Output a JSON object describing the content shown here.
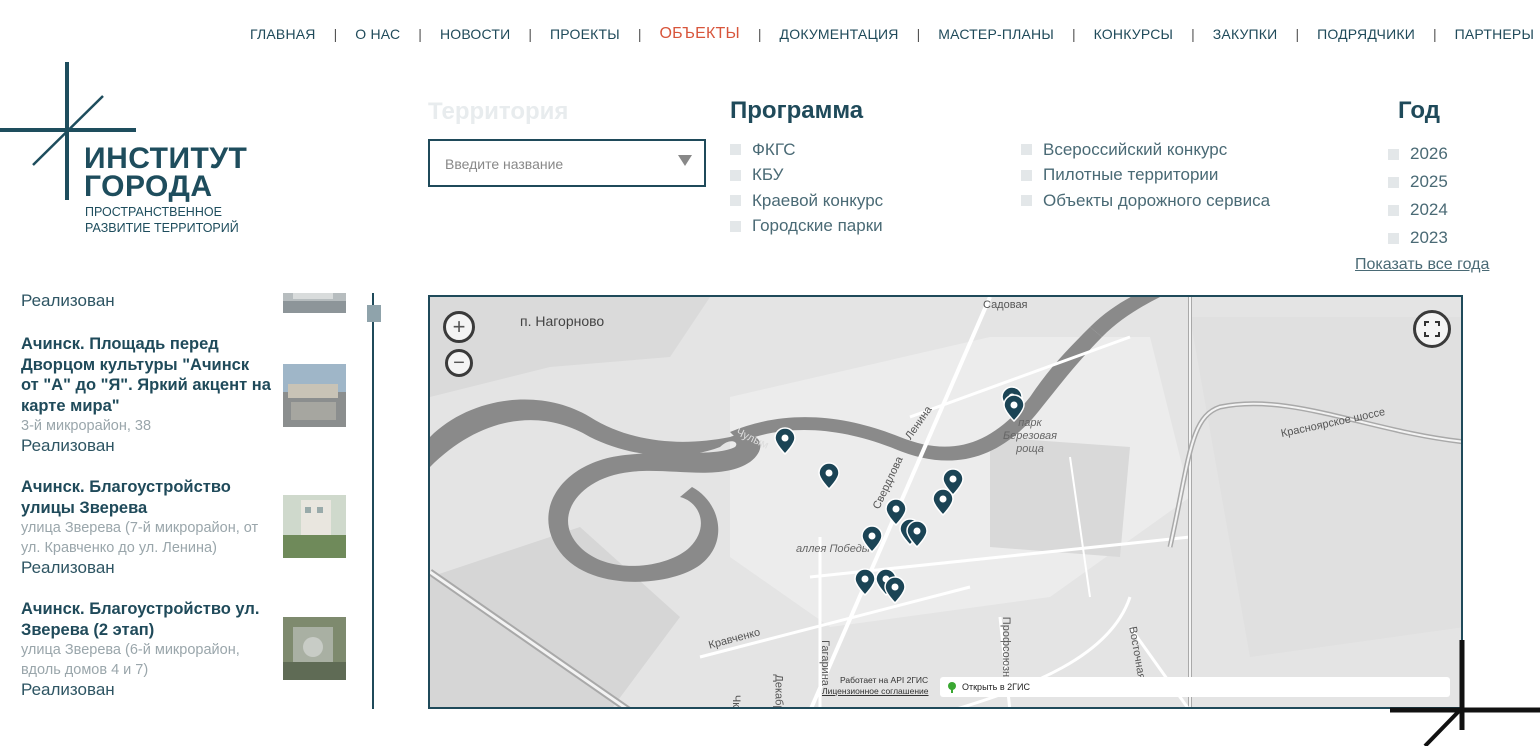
{
  "nav": {
    "items": [
      {
        "label": "ГЛАВНАЯ",
        "active": false
      },
      {
        "label": "О НАС",
        "active": false
      },
      {
        "label": "НОВОСТИ",
        "active": false
      },
      {
        "label": "ПРОЕКТЫ",
        "active": false
      },
      {
        "label": "ОБЪЕКТЫ",
        "active": true
      },
      {
        "label": "ДОКУМЕНТАЦИЯ",
        "active": false
      },
      {
        "label": "МАСТЕР-ПЛАНЫ",
        "active": false
      },
      {
        "label": "КОНКУРСЫ",
        "active": false
      },
      {
        "label": "ЗАКУПКИ",
        "active": false
      },
      {
        "label": "ПОДРЯДЧИКИ",
        "active": false
      },
      {
        "label": "ПАРТНЕРЫ",
        "active": false
      }
    ],
    "separator": "|",
    "active_color": "#d8553b"
  },
  "logo": {
    "line1": "ИНСТИТУТ",
    "line2": "ГОРОДА",
    "tagline1": "ПРОСТРАНСТВЕННОЕ",
    "tagline2": "РАЗВИТИЕ ТЕРРИТОРИЙ"
  },
  "filters": {
    "territory": {
      "label": "Территория",
      "placeholder": "Введите название"
    },
    "program": {
      "title": "Программа",
      "col1": [
        "ФКГС",
        "КБУ",
        "Краевой конкурс",
        "Городские парки"
      ],
      "col2": [
        "Всероссийский конкурс",
        "Пилотные территории",
        "Объекты дорожного сервиса"
      ]
    },
    "year": {
      "title": "Год",
      "options": [
        "2026",
        "2025",
        "2024",
        "2023"
      ],
      "show_all": "Показать все года"
    }
  },
  "list": {
    "top_status": "Реализован",
    "entries": [
      {
        "title": "Ачинск. Площадь перед Дворцом культуры \"Ачинск от \"А\" до \"Я\". Яркий акцент на карте мира\"",
        "address": "3-й микрорайон, 38",
        "status": "Реализован"
      },
      {
        "title": "Ачинск. Благоустройство улицы Зверева",
        "address": "улица Зверева (7-й микрорайон, от ул. Кравченко до ул. Ленина)",
        "status": "Реализован"
      },
      {
        "title": "Ачинск. Благоустройство ул. Зверева (2 этап)",
        "address": "улица Зверева (6-й микрорайон, вдоль домов 4 и 7)",
        "status": "Реализован"
      }
    ]
  },
  "map": {
    "zoom_in": "+",
    "zoom_out": "−",
    "labels": {
      "nagornovo": "п. Нагорново",
      "sadovaya": "Садовая",
      "lenina": "Ленина",
      "chulym": "Чулым",
      "sverdlova": "Свердлова",
      "park": "парк Березовая роща",
      "alley": "аллея Победы",
      "krasnoyarsk": "Красноярское шоссе",
      "kravchenko": "Кравченко",
      "gagarina": "Гагарина",
      "profsoyuznaya": "Профсоюзная",
      "vostochnaya": "Восточная",
      "dekabristov": "Декабр",
      "chk": "Чк"
    },
    "attribution1": "Работает на API 2ГИС",
    "attribution2": "Лицензионное соглашение",
    "open_2gis": "Открыть в 2ГИС",
    "pin_color": "#1b4455"
  }
}
